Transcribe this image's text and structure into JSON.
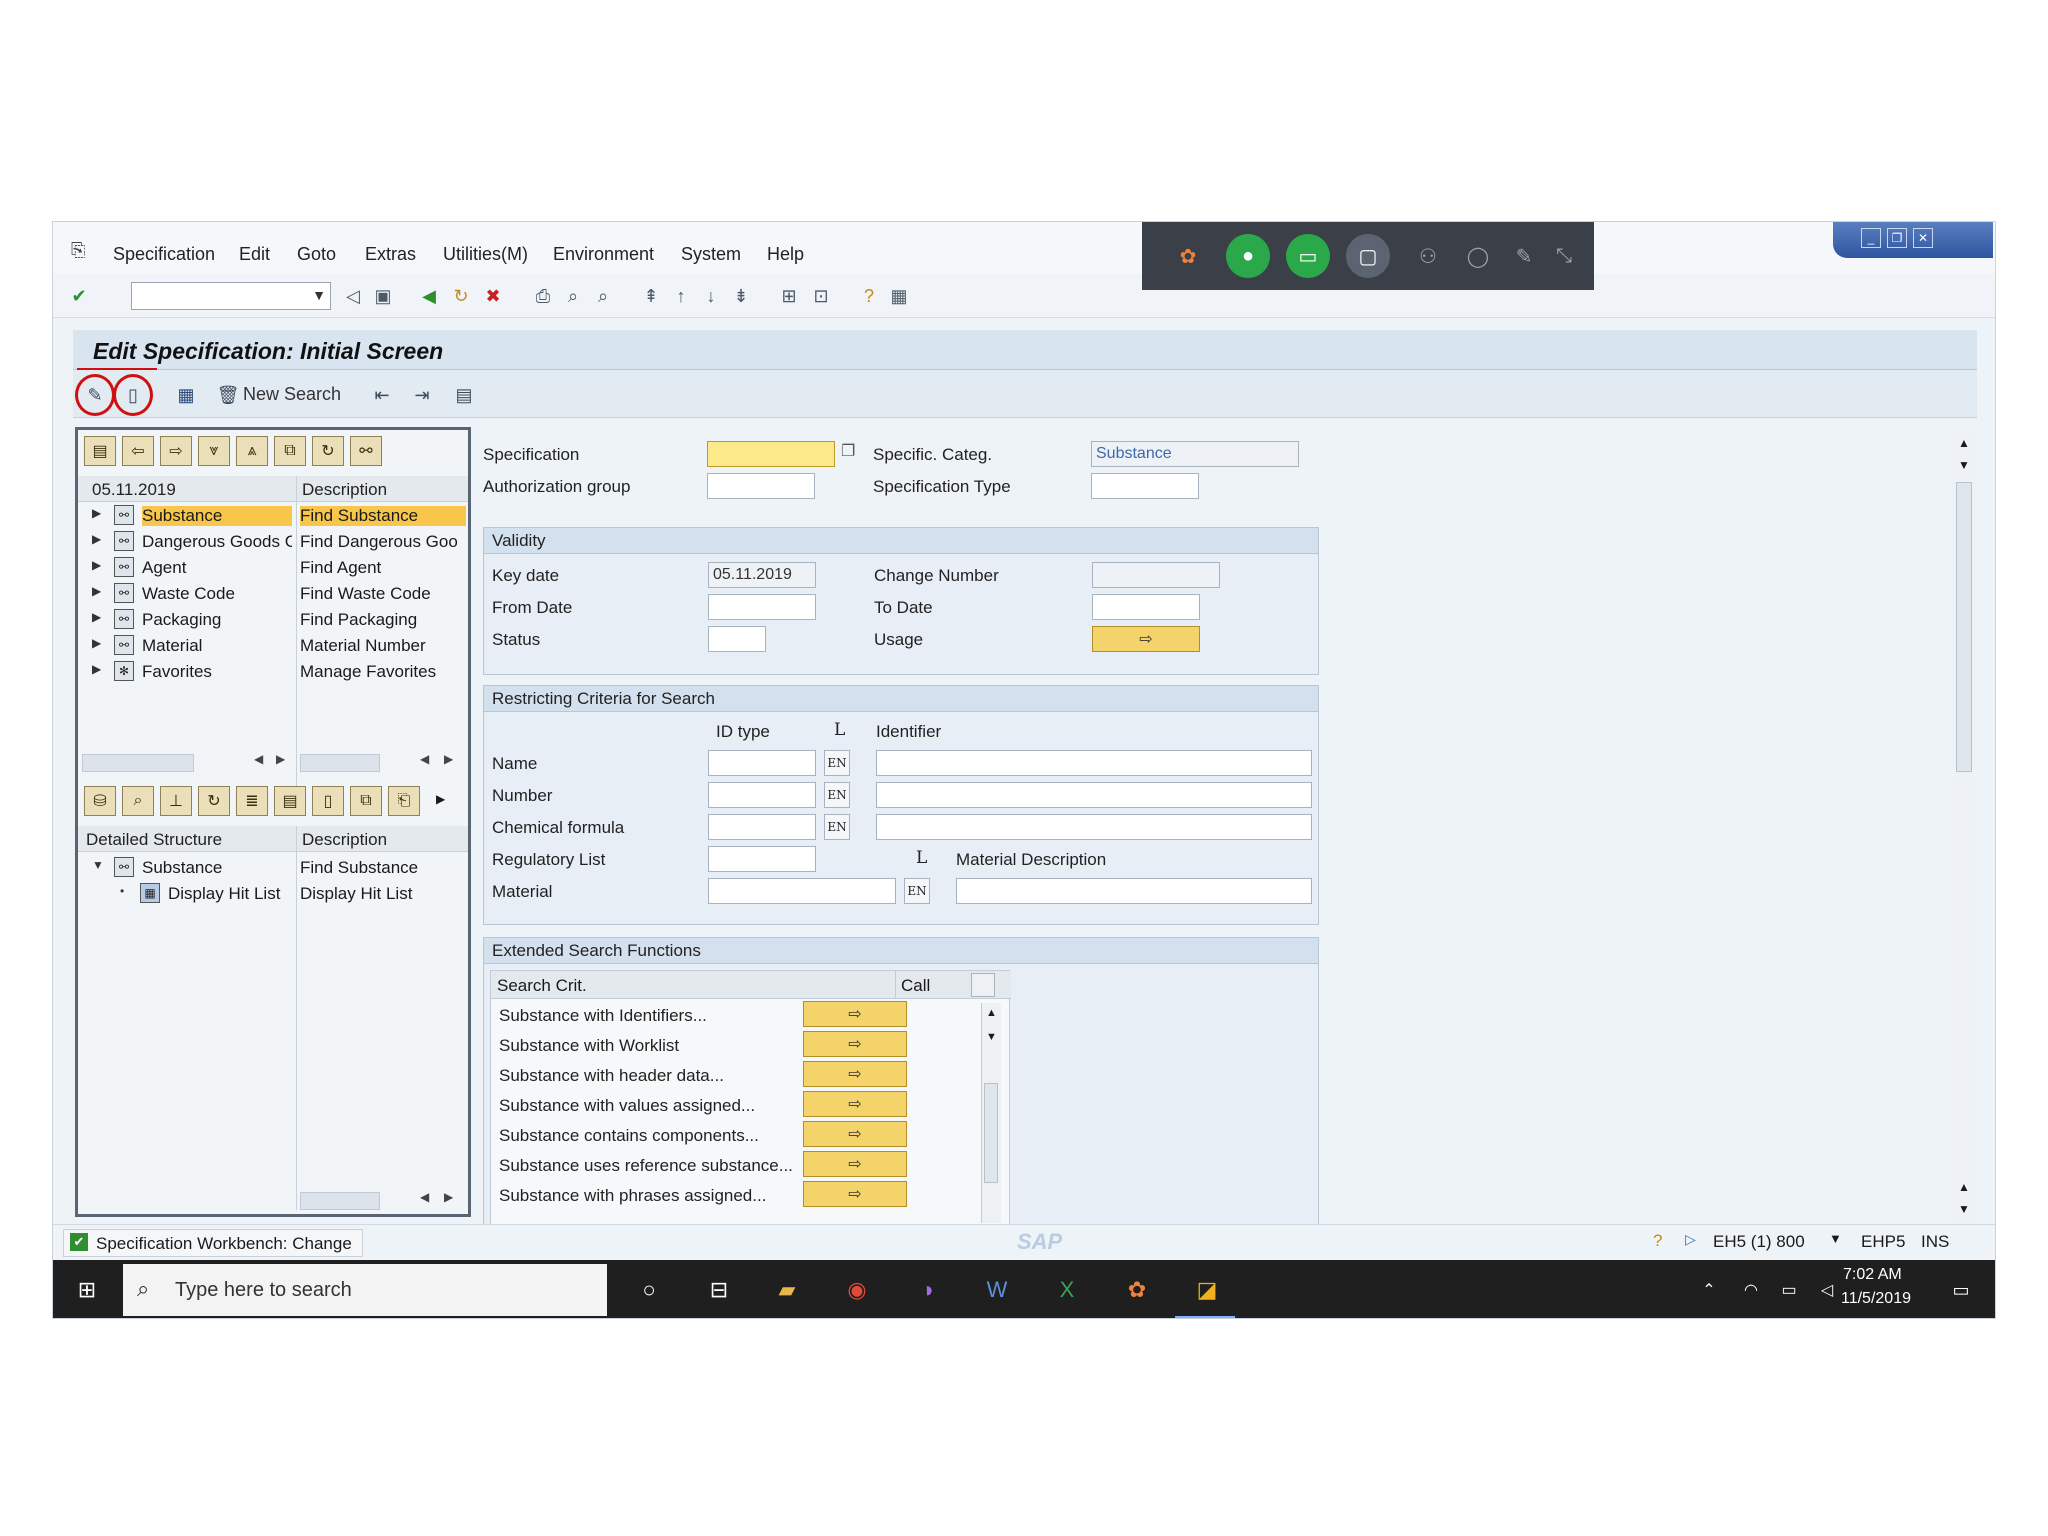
{
  "menu": {
    "items": [
      "Specification",
      "Edit",
      "Goto",
      "Extras",
      "Utilities(M)",
      "Environment",
      "System",
      "Help"
    ]
  },
  "command_field": {
    "value": ""
  },
  "page_title": "Edit Specification: Initial Screen",
  "app_toolbar": {
    "new_search": "New Search"
  },
  "left_panel": {
    "date": "05.11.2019",
    "description_header": "Description",
    "tree": [
      {
        "label": "Substance",
        "desc": "Find Substance"
      },
      {
        "label": "Dangerous Goods C",
        "desc": "Find Dangerous Goo"
      },
      {
        "label": "Agent",
        "desc": "Find Agent"
      },
      {
        "label": "Waste Code",
        "desc": "Find Waste Code"
      },
      {
        "label": "Packaging",
        "desc": "Find Packaging"
      },
      {
        "label": "Material",
        "desc": "Material Number"
      },
      {
        "label": "Favorites",
        "desc": "Manage Favorites"
      }
    ],
    "detail_header": "Detailed Structure",
    "detail_desc_header": "Description",
    "detail_tree": [
      {
        "label": "Substance",
        "desc": "Find Substance"
      },
      {
        "label": "Display Hit List",
        "desc": "Display Hit List"
      }
    ]
  },
  "form": {
    "specification_label": "Specification",
    "specification_value": "",
    "spec_categ_label": "Specific. Categ.",
    "spec_categ_value": "Substance",
    "auth_group_label": "Authorization group",
    "spec_type_label": "Specification Type",
    "validity": {
      "title": "Validity",
      "key_date_label": "Key date",
      "key_date_value": "05.11.2019",
      "change_number_label": "Change Number",
      "from_date_label": "From Date",
      "to_date_label": "To Date",
      "status_label": "Status",
      "usage_label": "Usage"
    },
    "restricting": {
      "title": "Restricting Criteria for Search",
      "id_type_header": "ID type",
      "l_header": "L",
      "identifier_header": "Identifier",
      "rows": [
        "Name",
        "Number",
        "Chemical formula"
      ],
      "lang": "EN",
      "regulatory_list_label": "Regulatory List",
      "l2_header": "L",
      "material_desc_header": "Material Description",
      "material_label": "Material"
    },
    "extended": {
      "title": "Extended Search Functions",
      "col_search": "Search Crit.",
      "col_call": "Call",
      "rows": [
        "Substance with Identifiers...",
        "Substance with Worklist",
        "Substance with header data...",
        "Substance with values assigned...",
        "Substance contains components...",
        "Substance uses reference substance...",
        "Substance with phrases assigned..."
      ]
    }
  },
  "status_bar": {
    "message": "Specification Workbench: Change",
    "system": "EH5 (1) 800",
    "client": "EHP5",
    "mode": "INS"
  },
  "taskbar": {
    "search_placeholder": "Type here to search",
    "time": "7:02 AM",
    "date": "11/5/2019"
  },
  "colors": {
    "selection": "#f7c64b",
    "annotation_red": "#d01010",
    "call_button": "#f5d36b"
  }
}
